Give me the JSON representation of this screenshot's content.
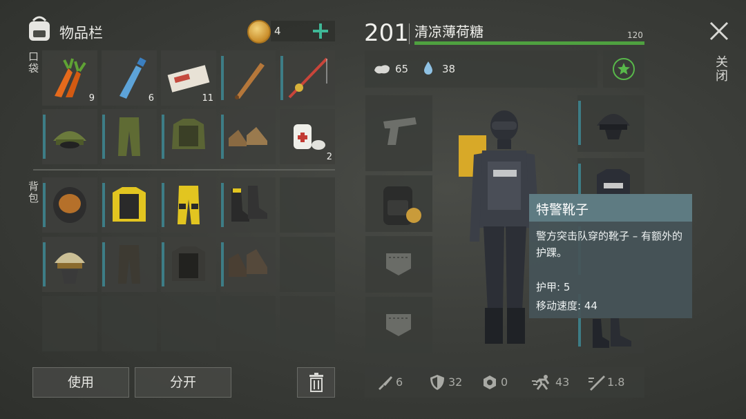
{
  "header": {
    "title": "物品栏",
    "coins": "4",
    "add_label": "+"
  },
  "sections": {
    "pockets": "口袋",
    "backpack": "背包"
  },
  "inventory": {
    "row1": [
      {
        "item": "carrots",
        "count": "9"
      },
      {
        "item": "water-bottle",
        "count": "6"
      },
      {
        "item": "ticket",
        "count": "11"
      },
      {
        "item": "baseball-bat",
        "count": ""
      },
      {
        "item": "fishing-rod",
        "count": ""
      }
    ],
    "row2": [
      {
        "item": "camo-cap",
        "count": ""
      },
      {
        "item": "camo-pants",
        "count": ""
      },
      {
        "item": "camo-vest",
        "count": ""
      },
      {
        "item": "brown-shoes",
        "count": ""
      },
      {
        "item": "bandage",
        "count": "2"
      }
    ]
  },
  "buttons": {
    "use": "使用",
    "split": "分开"
  },
  "character": {
    "level": "201",
    "name": "清凉薄荷糖",
    "xp_max": "120",
    "food": "65",
    "water": "38"
  },
  "bottom_stats": {
    "damage": "6",
    "armor": "32",
    "radiation": "0",
    "speed": "43",
    "attack_speed": "1.8"
  },
  "close_label": "关闭",
  "tooltip": {
    "title": "特警靴子",
    "description": "警方突击队穿的靴子 – 有额外的护踝。",
    "armor_line": "护甲: 5",
    "speed_line": "移动速度: 44"
  },
  "colors": {
    "accent_teal": "#3d7d86",
    "xp_green": "#4fa140",
    "add_green": "#3fb897",
    "fav_green": "#58b84a"
  }
}
